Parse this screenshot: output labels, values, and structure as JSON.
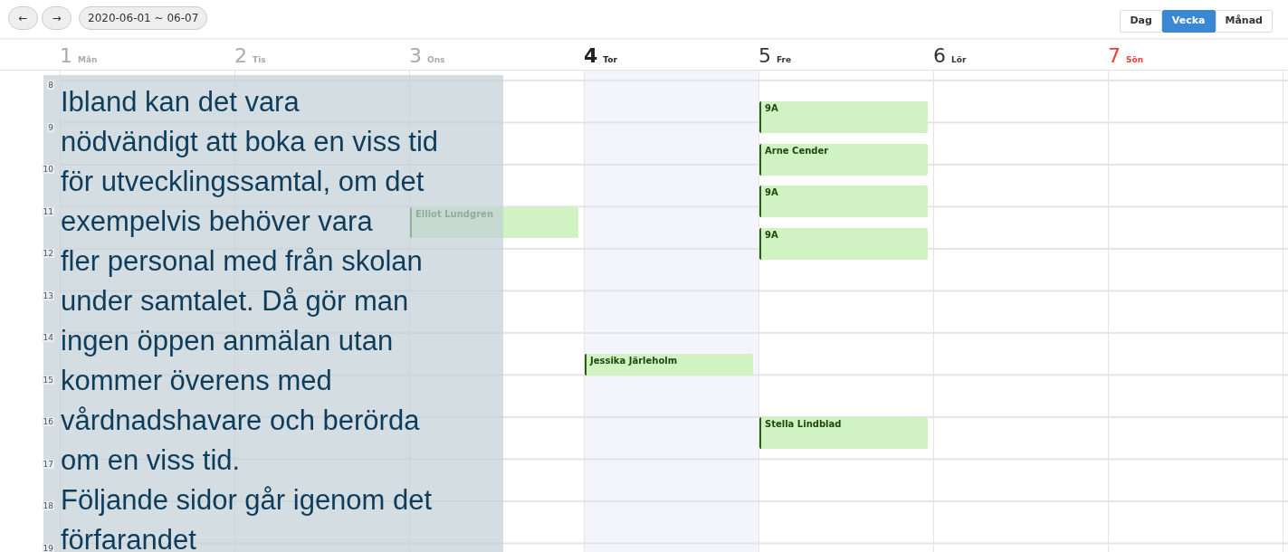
{
  "toolbar": {
    "prev": "←",
    "next": "→",
    "range": "2020-06-01 ~ 06-07"
  },
  "views": [
    {
      "label": "Dag",
      "selected": false
    },
    {
      "label": "Vecka",
      "selected": true
    },
    {
      "label": "Månad",
      "selected": false
    }
  ],
  "days": [
    {
      "number": "1",
      "name": "Mån",
      "past": true,
      "today": false,
      "holiday": false
    },
    {
      "number": "2",
      "name": "Tis",
      "past": true,
      "today": false,
      "holiday": false
    },
    {
      "number": "3",
      "name": "Ons",
      "past": true,
      "today": false,
      "holiday": false,
      "events": [
        {
          "title": "Elliot Lundgren"
        }
      ]
    },
    {
      "number": "4",
      "name": "Tor",
      "past": false,
      "today": true,
      "holiday": false,
      "events": [
        {
          "title": "Jessika Järleholm"
        }
      ]
    },
    {
      "number": "5",
      "name": "Fre",
      "past": false,
      "today": false,
      "holiday": false,
      "events": [
        {
          "title": "9A"
        },
        {
          "title": "Arne Cender"
        },
        {
          "title": "9A"
        },
        {
          "title": "9A"
        },
        {
          "title": "Stella Lindblad"
        }
      ]
    },
    {
      "number": "6",
      "name": "Lör",
      "past": false,
      "today": false,
      "holiday": false
    },
    {
      "number": "7",
      "name": "Sön",
      "past": false,
      "today": false,
      "holiday": true
    }
  ],
  "hours": [
    "8",
    "9",
    "10",
    "11",
    "12",
    "13",
    "14",
    "15",
    "16",
    "17",
    "18",
    "19"
  ],
  "overlay": {
    "lines": [
      "Ibland kan det vara",
      "nödvändigt att boka en viss tid",
      "för utvecklingssamtal, om det",
      "exempelvis behöver vara",
      "fler personal med från skolan",
      "under samtalet. Då gör man",
      "ingen öppen anmälan utan",
      "kommer överens med",
      "vårdnadshavare och berörda",
      "om en viss tid.",
      "Följande sidor går igenom det",
      "förfarandet"
    ]
  }
}
